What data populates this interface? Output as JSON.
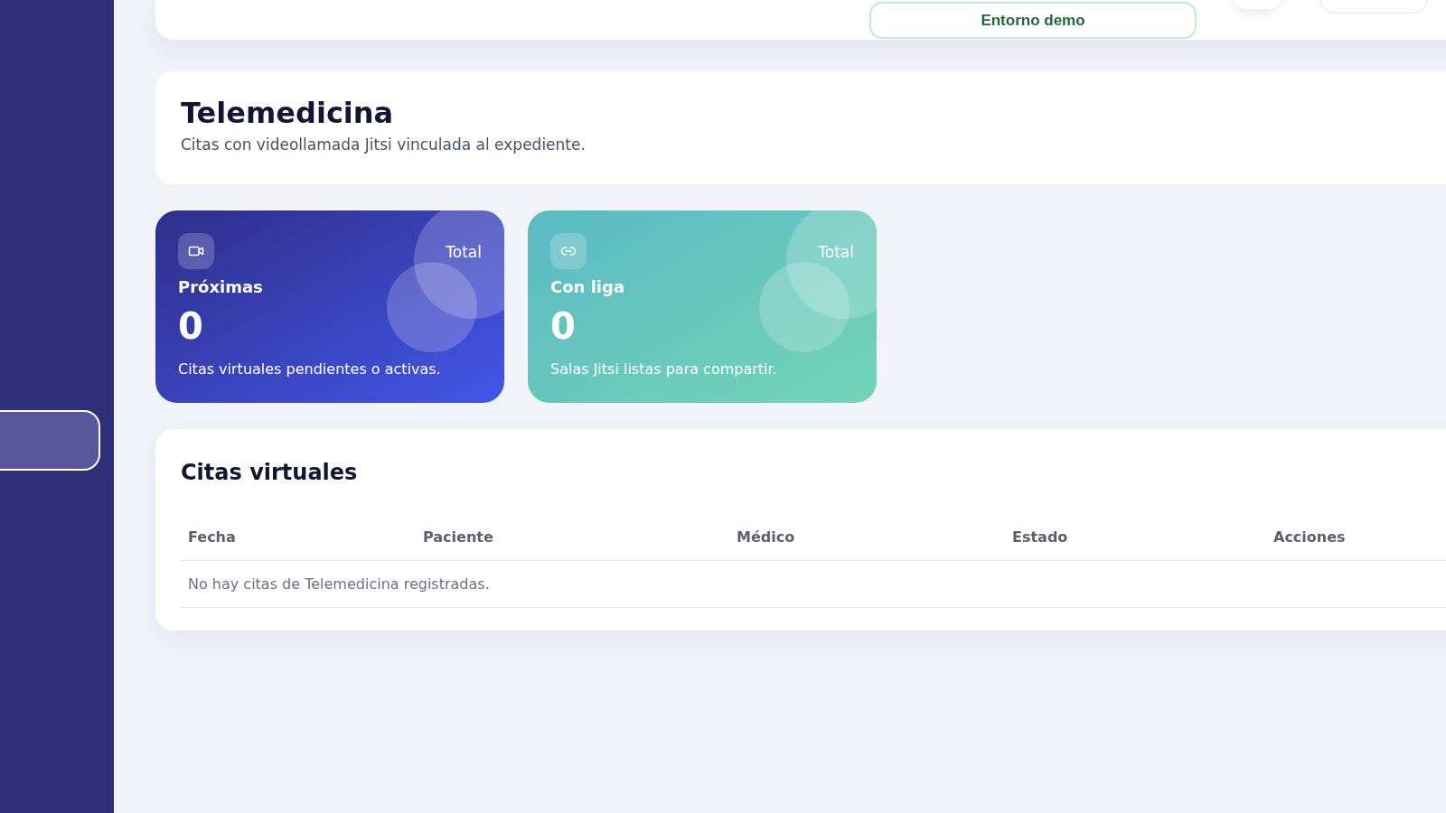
{
  "header": {
    "badge": "Entorno demo"
  },
  "page": {
    "title": "Telemedicina",
    "subtitle": "Citas con videollamada Jitsi vinculada al expediente."
  },
  "stats": [
    {
      "kind": "video",
      "label": "Próximas",
      "tag": "Total",
      "value": "0",
      "caption": "Citas virtuales pendientes o activas."
    },
    {
      "kind": "link",
      "label": "Con liga",
      "tag": "Total",
      "value": "0",
      "caption": "Salas Jitsi listas para compartir."
    }
  ],
  "table": {
    "title": "Citas virtuales",
    "columns": [
      "Fecha",
      "Paciente",
      "Médico",
      "Estado",
      "Acciones"
    ],
    "empty_message": "No hay citas de Telemedicina registradas."
  }
}
